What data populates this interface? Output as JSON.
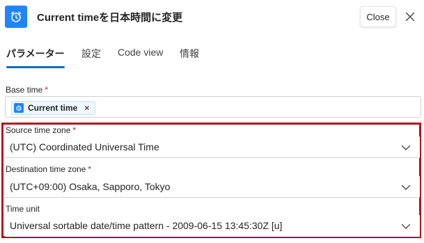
{
  "header": {
    "title": "Current timeを日本時間に変更",
    "close_label": "Close",
    "icon": "alarm-clock-icon",
    "accent_color": "#1f85ff"
  },
  "tabs": [
    {
      "label": "パラメーター",
      "active": true
    },
    {
      "label": "設定",
      "active": false
    },
    {
      "label": "Code view",
      "active": false
    },
    {
      "label": "情報",
      "active": false
    }
  ],
  "tab_underline_color": "#0f6cbd",
  "fields": {
    "base_time": {
      "label": "Base time",
      "required_mark": "*",
      "token_label": "Current time",
      "token_remove": "×"
    },
    "source_time_zone": {
      "label": "Source time zone",
      "required_mark": "*",
      "value": "(UTC) Coordinated Universal Time"
    },
    "destination_time_zone": {
      "label": "Destination time zone",
      "required_mark": "*",
      "value": "(UTC+09:00) Osaka, Sapporo, Tokyo"
    },
    "time_unit": {
      "label": "Time unit",
      "value": "Universal sortable date/time pattern - 2009-06-15 13:45:30Z [u]"
    }
  },
  "highlight_color": "#b4121e"
}
